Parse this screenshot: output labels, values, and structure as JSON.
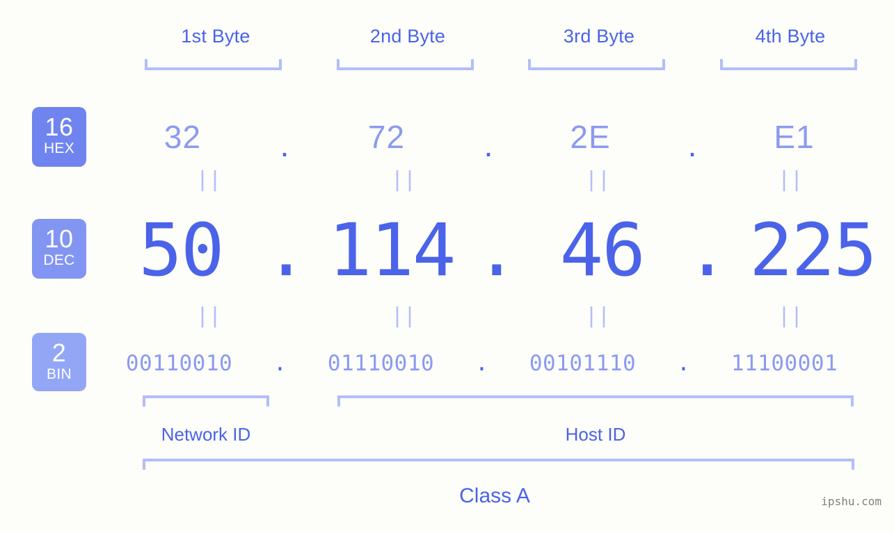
{
  "header": {
    "byte_labels": [
      "1st Byte",
      "2nd Byte",
      "3rd Byte",
      "4th Byte"
    ]
  },
  "bases": [
    {
      "number": "16",
      "name": "HEX",
      "color": "#7084ef"
    },
    {
      "number": "10",
      "name": "DEC",
      "color": "#8295f2"
    },
    {
      "number": "2",
      "name": "BIN",
      "color": "#93a6f6"
    }
  ],
  "separator": ".",
  "equals_mark": "||",
  "rows": {
    "hex": {
      "values": [
        "32",
        "72",
        "2E",
        "E1"
      ]
    },
    "dec": {
      "values": [
        "50",
        "114",
        "46",
        "225"
      ]
    },
    "bin": {
      "values": [
        "00110010",
        "01110010",
        "00101110",
        "11100001"
      ]
    }
  },
  "sections": {
    "network_id": "Network ID",
    "host_id": "Host ID",
    "class": "Class A"
  },
  "watermark": "ipshu.com",
  "colors": {
    "background": "#fdfdfa",
    "accent_strong": "#4a63e8",
    "accent_light": "#8b9af0",
    "bracket": "#b3bdfa"
  }
}
